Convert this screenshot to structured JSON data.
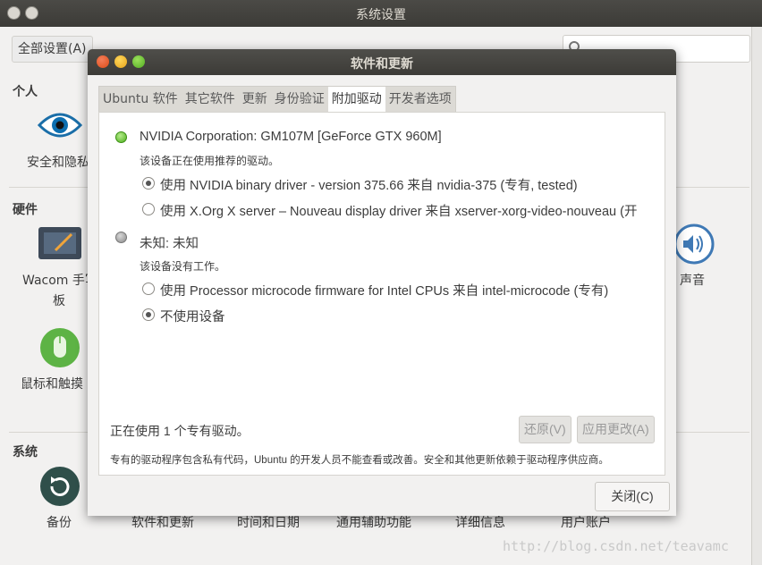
{
  "bg_window": {
    "title": "系统设置",
    "all_settings_label": "全部设置(A)",
    "sections": {
      "personal": "个人",
      "hardware": "硬件",
      "system": "系统"
    },
    "personal_items": [
      "安全和隐私"
    ],
    "hardware_items": [
      "Wacom 手写",
      "板",
      "鼠标和触摸",
      "声音"
    ],
    "system_items": [
      "备份",
      "软件和更新",
      "时间和日期",
      "通用辅助功能",
      "详细信息",
      "用户账户"
    ]
  },
  "dialog": {
    "title": "软件和更新",
    "tabs": [
      "Ubuntu 软件",
      "其它软件",
      "更新",
      "身份验证",
      "附加驱动",
      "开发者选项"
    ],
    "active_tab_index": 4,
    "devices": [
      {
        "title": "NVIDIA Corporation: GM107M [GeForce GTX 960M]",
        "subtitle": "该设备正在使用推荐的驱动。",
        "status": "green",
        "options": [
          {
            "label": "使用 NVIDIA binary driver - version 375.66 来自 nvidia-375 (专有, tested)",
            "selected": true
          },
          {
            "label": "使用 X.Org X server – Nouveau display driver 来自 xserver-xorg-video-nouveau (开",
            "selected": false
          }
        ]
      },
      {
        "title": "未知: 未知",
        "subtitle": "该设备没有工作。",
        "status": "gray",
        "options": [
          {
            "label": "使用 Processor microcode firmware for Intel CPUs 来自 intel-microcode (专有)",
            "selected": false
          },
          {
            "label": "不使用设备",
            "selected": true
          }
        ]
      }
    ],
    "status_text": "正在使用 1 个专有驱动。",
    "revert_label": "还原(V)",
    "apply_label": "应用更改(A)",
    "footnote": "专有的驱动程序包含私有代码，Ubuntu 的开发人员不能查看或改善。安全和其他更新依赖于驱动程序供应商。",
    "close_label": "关闭(C)"
  },
  "watermark": "http://blog.csdn.net/teavamc",
  "colors": {
    "accent_green": "#4caf1c",
    "titlebar": "#3c3b37"
  }
}
